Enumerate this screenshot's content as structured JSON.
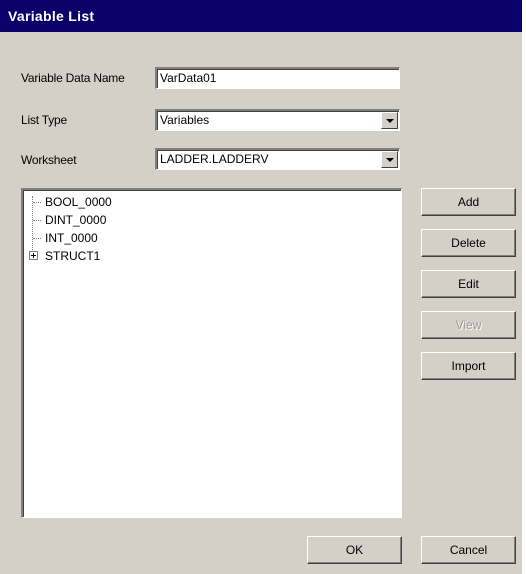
{
  "window": {
    "title": "Variable List"
  },
  "form": {
    "variable_data_name": {
      "label": "Variable Data Name",
      "value": "VarData01"
    },
    "list_type": {
      "label": "List Type",
      "value": "Variables"
    },
    "worksheet": {
      "label": "Worksheet",
      "value": "LADDER.LADDERV"
    }
  },
  "tree": {
    "items": [
      {
        "label": "BOOL_0000",
        "expandable": false
      },
      {
        "label": "DINT_0000",
        "expandable": false
      },
      {
        "label": "INT_0000",
        "expandable": false
      },
      {
        "label": "STRUCT1",
        "expandable": true
      }
    ]
  },
  "side_buttons": {
    "add": "Add",
    "delete": "Delete",
    "edit": "Edit",
    "view": "View",
    "import": "Import"
  },
  "footer": {
    "ok": "OK",
    "cancel": "Cancel"
  },
  "colors": {
    "titlebar": "#0a006a",
    "face": "#d4d0c8"
  }
}
